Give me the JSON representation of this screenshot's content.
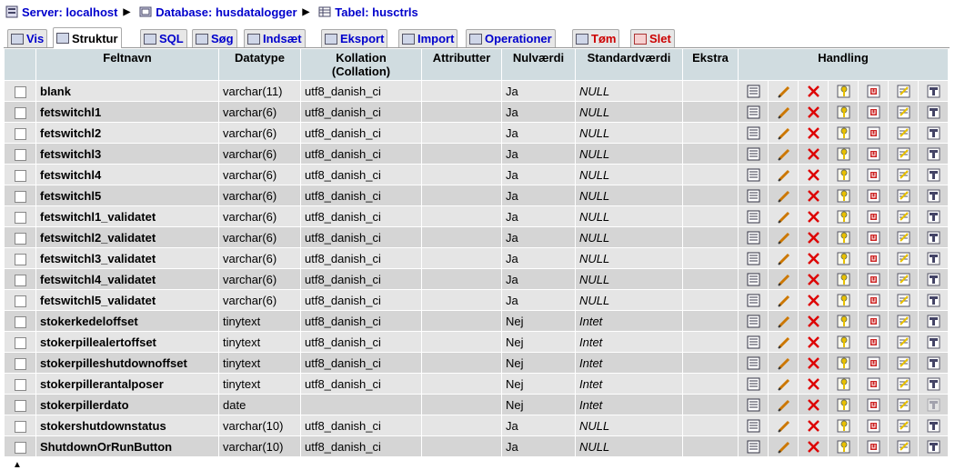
{
  "breadcrumb": {
    "server_label": "Server: localhost",
    "database_label": "Database: husdatalogger",
    "table_label": "Tabel: husctrls"
  },
  "tabs": [
    {
      "label": "Vis",
      "icon": "browse-icon"
    },
    {
      "label": "Struktur",
      "icon": "structure-icon"
    },
    {
      "label": "SQL",
      "icon": "sql-icon"
    },
    {
      "label": "Søg",
      "icon": "search-icon"
    },
    {
      "label": "Indsæt",
      "icon": "insert-icon"
    },
    {
      "label": "Eksport",
      "icon": "export-icon"
    },
    {
      "label": "Import",
      "icon": "import-icon"
    },
    {
      "label": "Operationer",
      "icon": "operations-icon"
    },
    {
      "label": "Tøm",
      "icon": "empty-icon"
    },
    {
      "label": "Slet",
      "icon": "drop-icon"
    }
  ],
  "table": {
    "headers": {
      "field": "Feltnavn",
      "type": "Datatype",
      "collation_line1": "Kollation",
      "collation_line2": "(Collation)",
      "attributes": "Attributter",
      "null": "Nulværdi",
      "default": "Standardværdi",
      "extra": "Ekstra",
      "action": "Handling"
    },
    "rows": [
      {
        "field": "blank",
        "type": "varchar(11)",
        "collation": "utf8_danish_ci",
        "null": "Ja",
        "default": "NULL"
      },
      {
        "field": "fetswitchl1",
        "type": "varchar(6)",
        "collation": "utf8_danish_ci",
        "null": "Ja",
        "default": "NULL"
      },
      {
        "field": "fetswitchl2",
        "type": "varchar(6)",
        "collation": "utf8_danish_ci",
        "null": "Ja",
        "default": "NULL"
      },
      {
        "field": "fetswitchl3",
        "type": "varchar(6)",
        "collation": "utf8_danish_ci",
        "null": "Ja",
        "default": "NULL"
      },
      {
        "field": "fetswitchl4",
        "type": "varchar(6)",
        "collation": "utf8_danish_ci",
        "null": "Ja",
        "default": "NULL"
      },
      {
        "field": "fetswitchl5",
        "type": "varchar(6)",
        "collation": "utf8_danish_ci",
        "null": "Ja",
        "default": "NULL"
      },
      {
        "field": "fetswitchl1_validatet",
        "type": "varchar(6)",
        "collation": "utf8_danish_ci",
        "null": "Ja",
        "default": "NULL"
      },
      {
        "field": "fetswitchl2_validatet",
        "type": "varchar(6)",
        "collation": "utf8_danish_ci",
        "null": "Ja",
        "default": "NULL"
      },
      {
        "field": "fetswitchl3_validatet",
        "type": "varchar(6)",
        "collation": "utf8_danish_ci",
        "null": "Ja",
        "default": "NULL"
      },
      {
        "field": "fetswitchl4_validatet",
        "type": "varchar(6)",
        "collation": "utf8_danish_ci",
        "null": "Ja",
        "default": "NULL"
      },
      {
        "field": "fetswitchl5_validatet",
        "type": "varchar(6)",
        "collation": "utf8_danish_ci",
        "null": "Ja",
        "default": "NULL"
      },
      {
        "field": "stokerkedeloffset",
        "type": "tinytext",
        "collation": "utf8_danish_ci",
        "null": "Nej",
        "default": "Intet"
      },
      {
        "field": "stokerpillealertoffset",
        "type": "tinytext",
        "collation": "utf8_danish_ci",
        "null": "Nej",
        "default": "Intet"
      },
      {
        "field": "stokerpilleshutdownoffset",
        "type": "tinytext",
        "collation": "utf8_danish_ci",
        "null": "Nej",
        "default": "Intet"
      },
      {
        "field": "stokerpillerantalposer",
        "type": "tinytext",
        "collation": "utf8_danish_ci",
        "null": "Nej",
        "default": "Intet"
      },
      {
        "field": "stokerpillerdato",
        "type": "date",
        "collation": "",
        "null": "Nej",
        "default": "Intet"
      },
      {
        "field": "stokershutdownstatus",
        "type": "varchar(10)",
        "collation": "utf8_danish_ci",
        "null": "Ja",
        "default": "NULL"
      },
      {
        "field": "ShutdownOrRunButton",
        "type": "varchar(10)",
        "collation": "utf8_danish_ci",
        "null": "Ja",
        "default": "NULL"
      }
    ],
    "action_icons": [
      "browse-distinct-icon",
      "edit-icon",
      "drop-icon",
      "primary-key-icon",
      "unique-icon",
      "index-icon",
      "fulltext-icon"
    ]
  },
  "colors": {
    "link": "#0000cc",
    "header_bg": "#d0dce0",
    "row_odd": "#e5e5e5",
    "row_even": "#d5d5d5",
    "danger": "#cc0000"
  }
}
